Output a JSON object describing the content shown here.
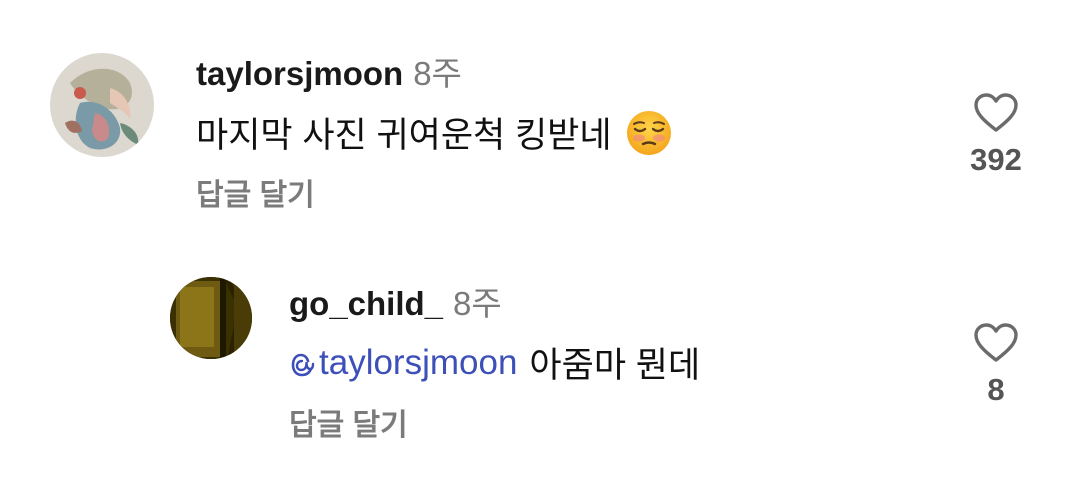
{
  "comments": [
    {
      "username": "taylorsjmoon",
      "time": "8주",
      "text": "마지막 사진 귀여운척 킹받네",
      "emoji": "relieved-face",
      "reply_label": "답글 달기",
      "likes": "392"
    },
    {
      "username": "go_child_",
      "time": "8주",
      "mention": "taylorsjmoon",
      "text": "아줌마 뭔데",
      "reply_label": "답글 달기",
      "likes": "8"
    }
  ],
  "colors": {
    "mention": "#3d4fb8",
    "secondary_text": "#7b7b7b"
  }
}
